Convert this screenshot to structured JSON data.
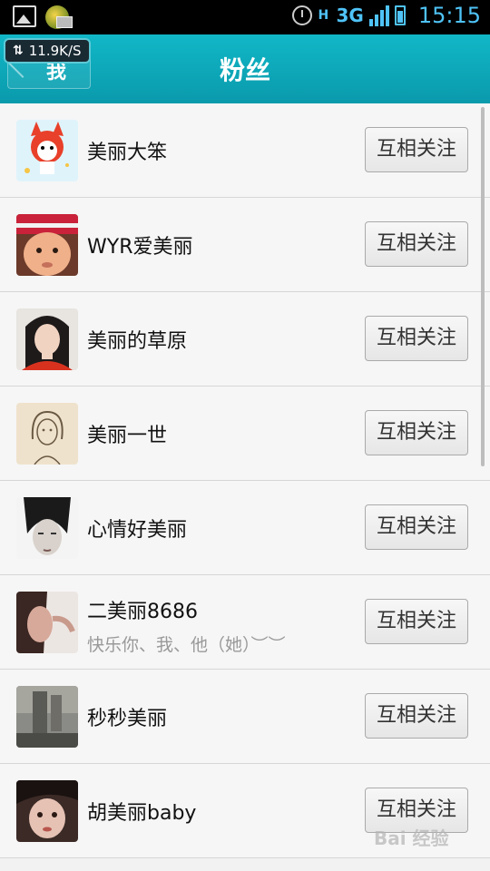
{
  "status_bar": {
    "network": "3G",
    "network_mode": "H",
    "time": "15:15"
  },
  "header": {
    "back_label": "我",
    "title": "粉丝",
    "speed_badge": "11.9K/S",
    "speed_arrows": "⇅"
  },
  "fans": [
    {
      "name": "美丽大笨",
      "action": "互相关注",
      "avatar": "cartoon-fox"
    },
    {
      "name": "WYR爱美丽",
      "action": "互相关注",
      "avatar": "baby-photo"
    },
    {
      "name": "美丽的草原",
      "action": "互相关注",
      "avatar": "woman-photo"
    },
    {
      "name": "美丽一世",
      "action": "互相关注",
      "avatar": "sketch-portrait"
    },
    {
      "name": "心情好美丽",
      "action": "互相关注",
      "avatar": "bw-portrait"
    },
    {
      "name": "二美丽8686",
      "subtext": "快乐你、我、他（她）︶︶",
      "action": "互相关注",
      "avatar": "hand-photo"
    },
    {
      "name": "秒秒美丽",
      "action": "互相关注",
      "avatar": "stone-tablet"
    },
    {
      "name": "胡美丽baby",
      "action": "互相关注",
      "avatar": "selfie-photo"
    }
  ],
  "watermark": "Bai 经验"
}
